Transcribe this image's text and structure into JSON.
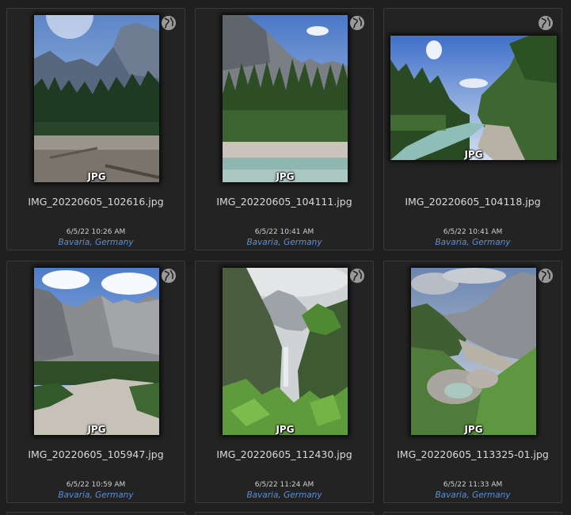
{
  "tiles": [
    {
      "filename": "IMG_20220605_102616.jpg",
      "date": "6/5/22 10:26 AM",
      "location": "Bavaria, Germany",
      "badge": "JPG",
      "globe_icon": "globe-icon"
    },
    {
      "filename": "IMG_20220605_104111.jpg",
      "date": "6/5/22 10:41 AM",
      "location": "Bavaria, Germany",
      "badge": "JPG",
      "globe_icon": "globe-icon"
    },
    {
      "filename": "IMG_20220605_104118.jpg",
      "date": "6/5/22 10:41 AM",
      "location": "Bavaria, Germany",
      "badge": "JPG",
      "globe_icon": "globe-icon"
    },
    {
      "filename": "IMG_20220605_105947.jpg",
      "date": "6/5/22 10:59 AM",
      "location": "Bavaria, Germany",
      "badge": "JPG",
      "globe_icon": "globe-icon"
    },
    {
      "filename": "IMG_20220605_112430.jpg",
      "date": "6/5/22 11:24 AM",
      "location": "Bavaria, Germany",
      "badge": "JPG",
      "globe_icon": "globe-icon"
    },
    {
      "filename": "IMG_20220605_113325-01.jpg",
      "date": "6/5/22 11:33 AM",
      "location": "Bavaria, Germany",
      "badge": "JPG",
      "globe_icon": "globe-icon"
    }
  ],
  "colors": {
    "background": "#1f1f1f",
    "tile_border": "#3a3a3a",
    "filename_text": "#d9d9d9",
    "location_link": "#5b8fd6"
  }
}
